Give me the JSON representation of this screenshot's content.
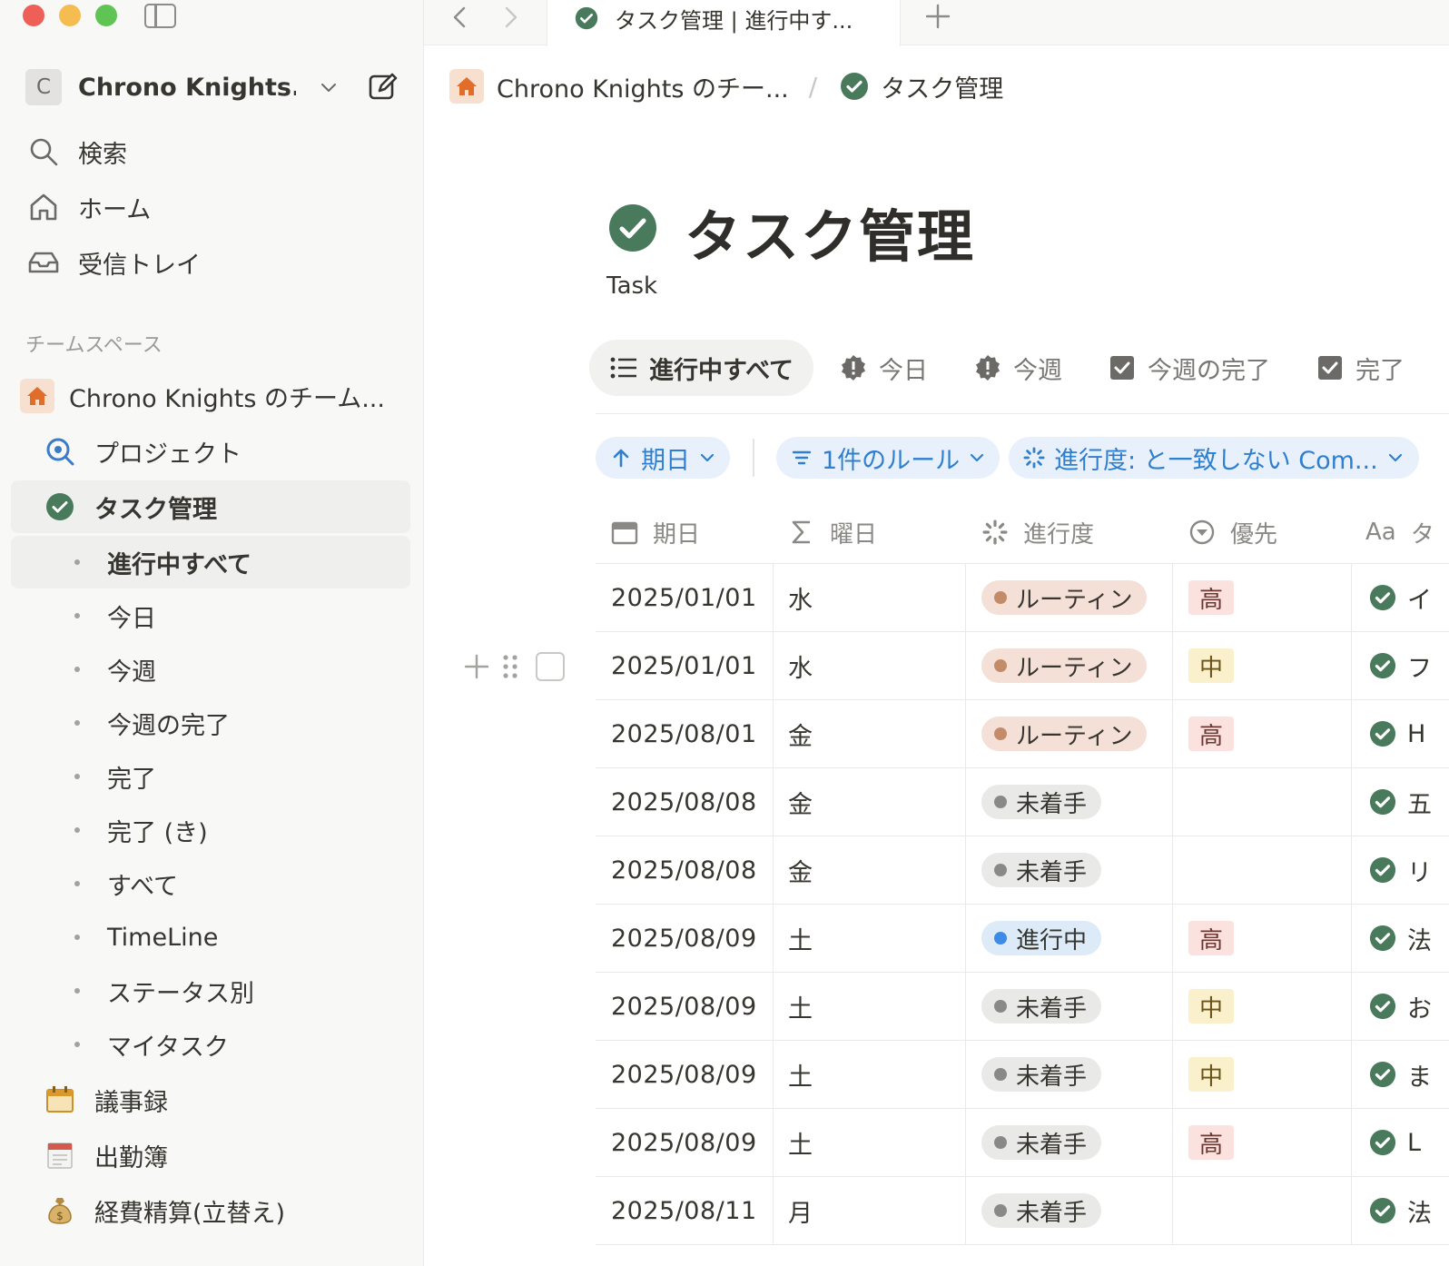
{
  "window": {
    "sidebar_toggle_icon": "sidebar-toggle-icon"
  },
  "tab": {
    "title": "タスク管理 | 進行中す..."
  },
  "workspace": {
    "avatar_letter": "C",
    "name": "Chrono Knights..."
  },
  "sidebar": {
    "nav": [
      {
        "label": "検索",
        "icon": "search-icon"
      },
      {
        "label": "ホーム",
        "icon": "home-icon"
      },
      {
        "label": "受信トレイ",
        "icon": "inbox-icon"
      }
    ],
    "section_label": "チームスペース",
    "teamspace": {
      "label": "Chrono Knights のチーム...",
      "icon": "house-icon"
    },
    "project": {
      "label": "プロジェクト",
      "icon": "project-icon"
    },
    "task": {
      "label": "タスク管理",
      "icon": "check-circle-icon"
    },
    "views": [
      {
        "label": "進行中すべて",
        "selected": true
      },
      {
        "label": "今日"
      },
      {
        "label": "今週"
      },
      {
        "label": "今週の完了"
      },
      {
        "label": "完了"
      },
      {
        "label": "完了 (き)"
      },
      {
        "label": "すべて"
      },
      {
        "label": "TimeLine"
      },
      {
        "label": "ステータス別"
      },
      {
        "label": "マイタスク"
      }
    ],
    "pages": [
      {
        "label": "議事録",
        "icon": "calendar-icon"
      },
      {
        "label": "出勤簿",
        "icon": "tear-off-calendar-icon"
      },
      {
        "label": "経費精算(立替え)",
        "icon": "money-bag-icon"
      }
    ]
  },
  "breadcrumb": {
    "team": "Chrono Knights のチー...",
    "separator": "/",
    "page": "タスク管理"
  },
  "page": {
    "title": "タスク管理",
    "description": "Task"
  },
  "view_tabs": [
    {
      "label": "進行中すべて",
      "icon": "list-icon",
      "active": true
    },
    {
      "label": "今日",
      "icon": "badge-alert-icon"
    },
    {
      "label": "今週",
      "icon": "badge-alert-icon"
    },
    {
      "label": "今週の完了",
      "icon": "checkbox-icon"
    },
    {
      "label": "完了",
      "icon": "checkbox-icon"
    }
  ],
  "filters": {
    "sort": "期日",
    "rules": "1件のルール",
    "progress": "進行度: と一致しない Com..."
  },
  "columns": {
    "date": "期日",
    "day": "曜日",
    "status": "進行度",
    "priority": "優先",
    "task_prefix": "Aa",
    "task_cut": "タ"
  },
  "colors": {
    "routine_bg": "#f4e0d7",
    "routine_dot": "#c48b68",
    "todo_bg": "#e9e9e7",
    "todo_dot": "#8a8985",
    "inprogress_bg": "#dcebf7",
    "inprogress_dot": "#3c8ce7",
    "high_bg": "#fbe2df",
    "high_fg": "#6e3630",
    "mid_bg": "#fbf0cc",
    "mid_fg": "#6b5417",
    "check_green": "#4a7a5c"
  },
  "rows": [
    {
      "date": "2025/01/01",
      "day": "水",
      "status": "ルーティン",
      "status_kind": "routine",
      "priority": "高",
      "task": "イ"
    },
    {
      "date": "2025/01/01",
      "day": "水",
      "status": "ルーティン",
      "status_kind": "routine",
      "priority": "中",
      "task": "フ"
    },
    {
      "date": "2025/08/01",
      "day": "金",
      "status": "ルーティン",
      "status_kind": "routine",
      "priority": "高",
      "task": "H"
    },
    {
      "date": "2025/08/08",
      "day": "金",
      "status": "未着手",
      "status_kind": "todo",
      "priority": "",
      "task": "五"
    },
    {
      "date": "2025/08/08",
      "day": "金",
      "status": "未着手",
      "status_kind": "todo",
      "priority": "",
      "task": "リ"
    },
    {
      "date": "2025/08/09",
      "day": "土",
      "status": "進行中",
      "status_kind": "inprogress",
      "priority": "高",
      "task": "法"
    },
    {
      "date": "2025/08/09",
      "day": "土",
      "status": "未着手",
      "status_kind": "todo",
      "priority": "中",
      "task": "お"
    },
    {
      "date": "2025/08/09",
      "day": "土",
      "status": "未着手",
      "status_kind": "todo",
      "priority": "中",
      "task": "ま"
    },
    {
      "date": "2025/08/09",
      "day": "土",
      "status": "未着手",
      "status_kind": "todo",
      "priority": "高",
      "task": "L"
    },
    {
      "date": "2025/08/11",
      "day": "月",
      "status": "未着手",
      "status_kind": "todo",
      "priority": "",
      "task": "法"
    }
  ]
}
